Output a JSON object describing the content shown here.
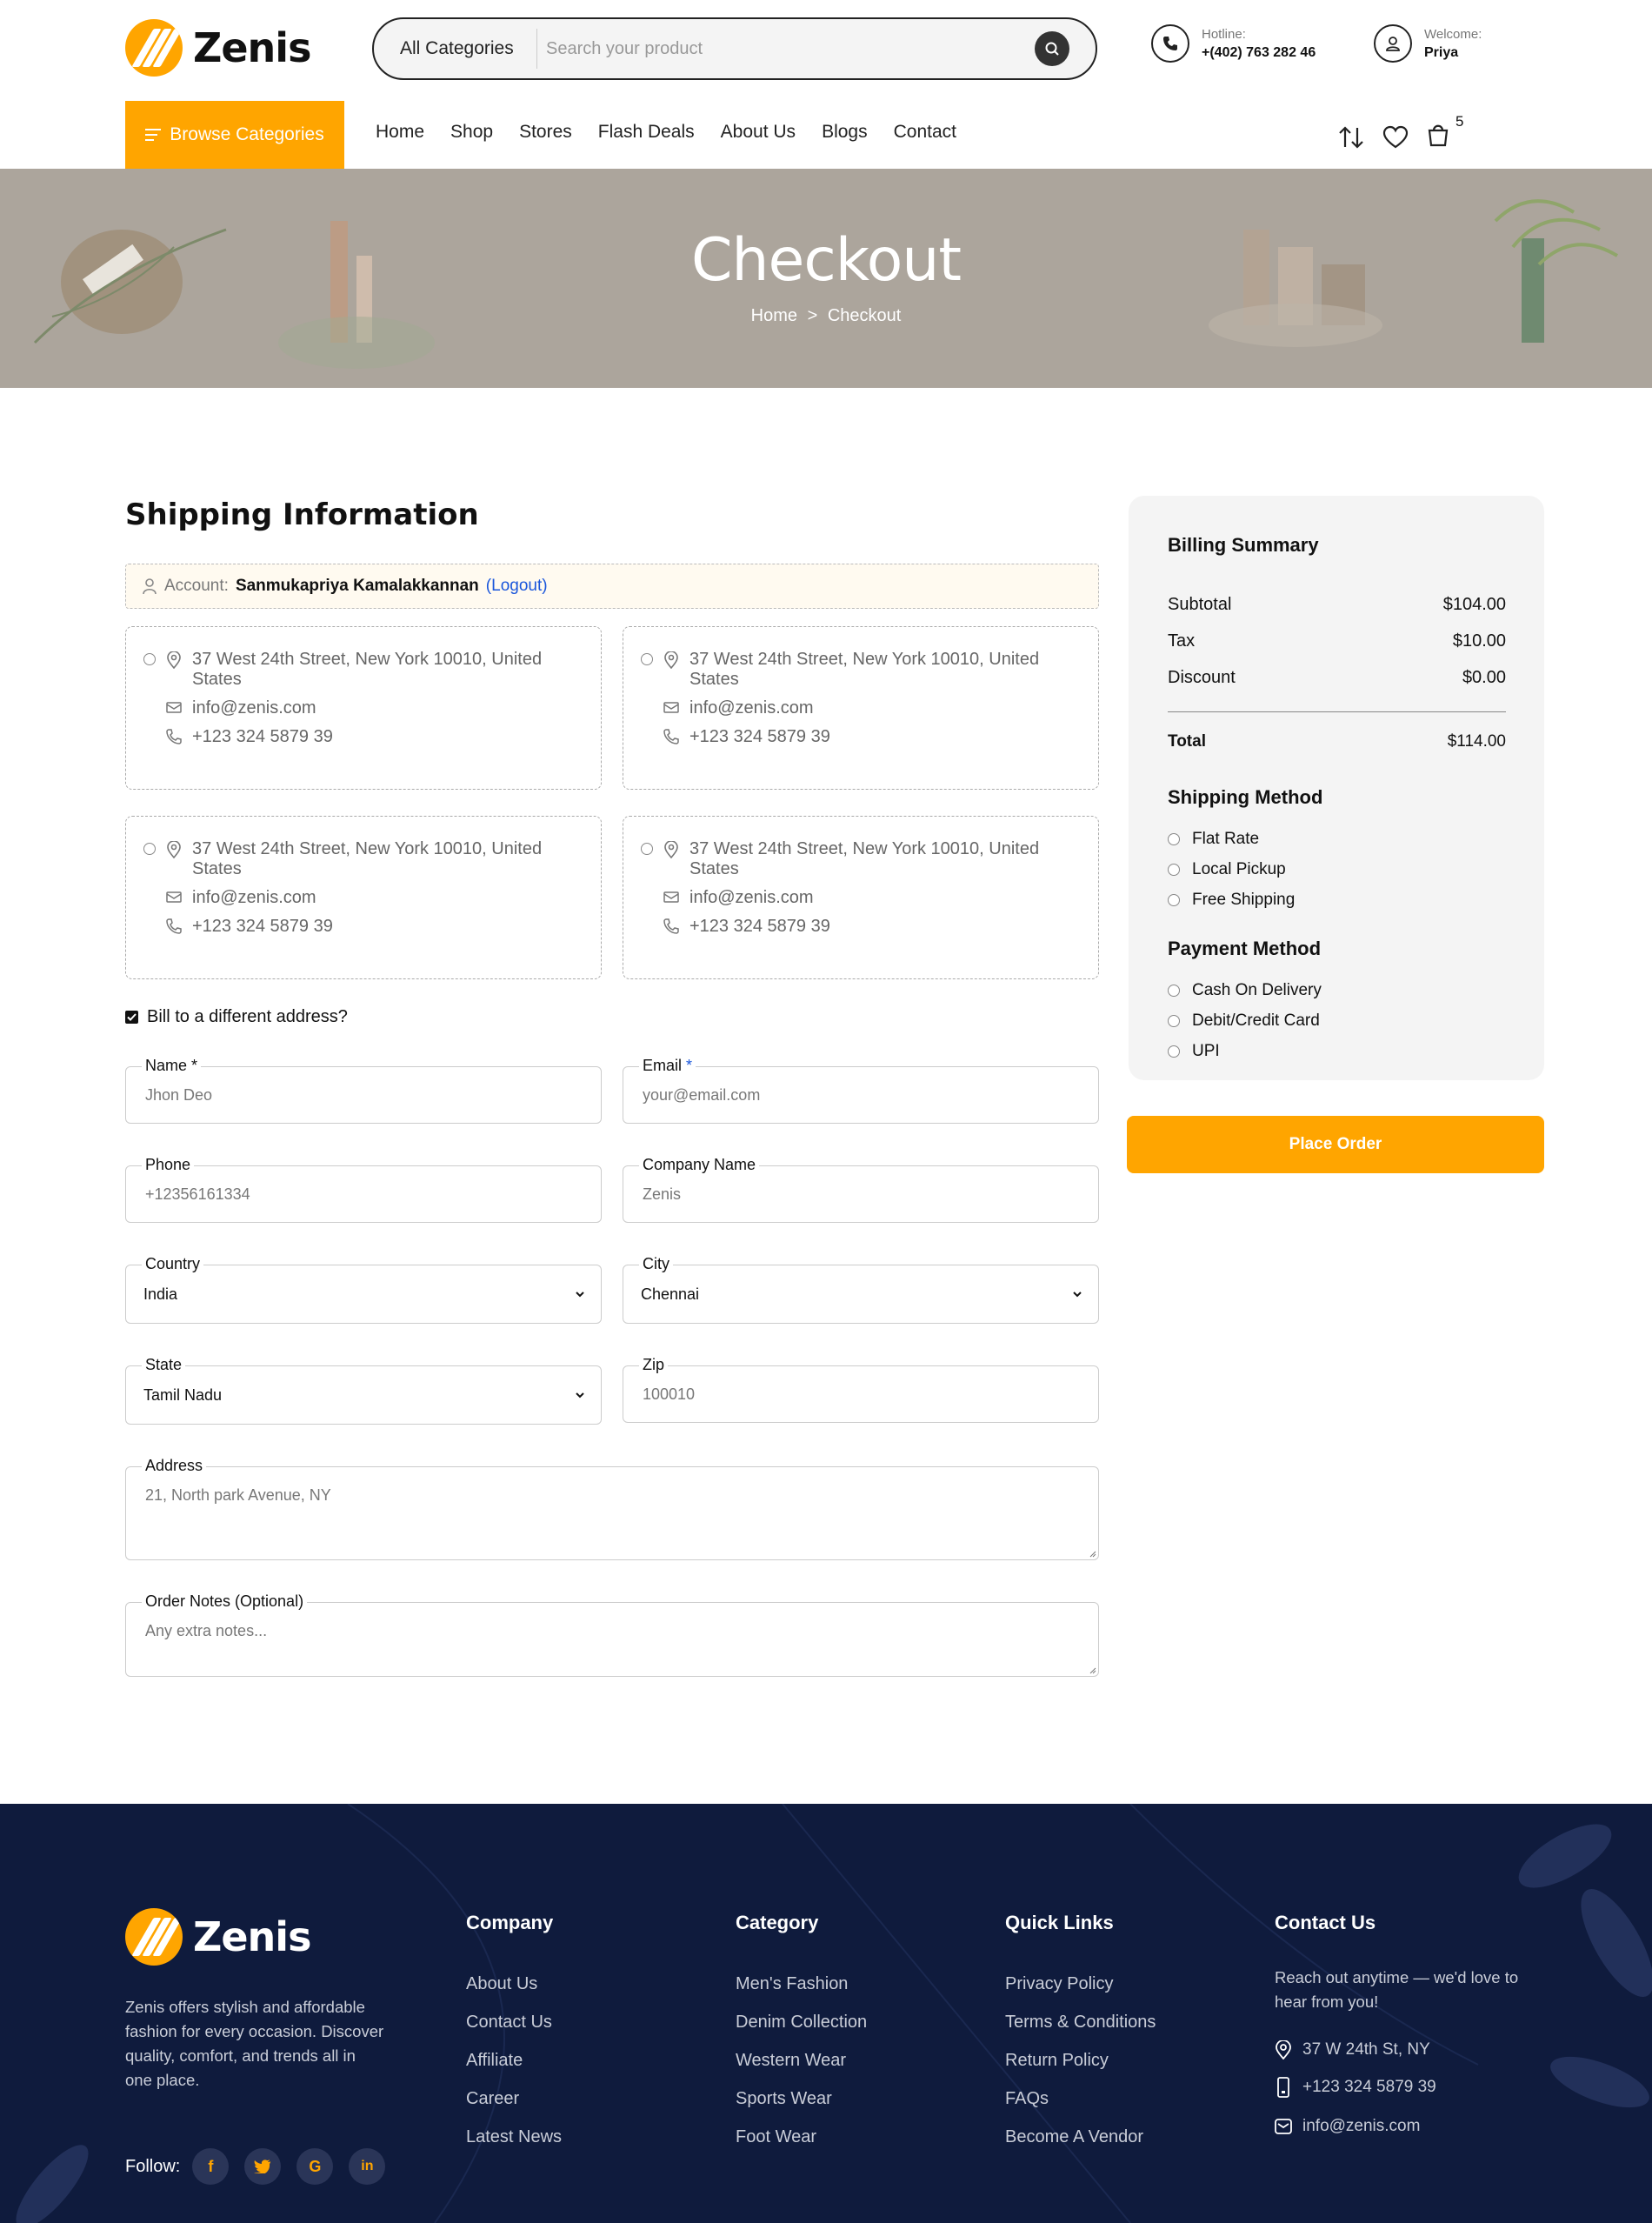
{
  "header": {
    "brand": "Zenis",
    "search_category": "All Categories",
    "search_placeholder": "Search your product",
    "hotline_label": "Hotline:",
    "hotline_number": "+(402) 763 282 46",
    "welcome_label": "Welcome:",
    "welcome_user": "Priya",
    "browse_label": "Browse Categories",
    "nav": [
      "Home",
      "Shop",
      "Stores",
      "Flash Deals",
      "About Us",
      "Blogs",
      "Contact"
    ],
    "cart_count": "5"
  },
  "hero": {
    "title": "Checkout",
    "breadcrumb_home": "Home",
    "breadcrumb_sep": ">",
    "breadcrumb_current": "Checkout"
  },
  "shipping": {
    "title": "Shipping Information",
    "account_label": "Account:",
    "account_name": "Sanmukapriya Kamalakkannan",
    "logout": "(Logout)",
    "addresses": [
      {
        "street": "37 West 24th Street, New York 10010, United States",
        "email": "info@zenis.com",
        "phone": "+123 324 5879 39"
      },
      {
        "street": "37 West 24th Street, New York 10010, United States",
        "email": "info@zenis.com",
        "phone": "+123 324 5879 39"
      },
      {
        "street": "37 West 24th Street, New York 10010, United States",
        "email": "info@zenis.com",
        "phone": "+123 324 5879 39"
      },
      {
        "street": "37 West 24th Street, New York 10010, United States",
        "email": "info@zenis.com",
        "phone": "+123 324 5879 39"
      }
    ],
    "bill_different": "Bill to a different address?",
    "form": {
      "name_label": "Name",
      "name_placeholder": "Jhon Deo",
      "email_label": "Email",
      "email_placeholder": "your@email.com",
      "phone_label": "Phone",
      "phone_placeholder": "+12356161334",
      "company_label": "Company Name",
      "company_placeholder": "Zenis",
      "country_label": "Country",
      "country_value": "India",
      "city_label": "City",
      "city_value": "Chennai",
      "state_label": "State",
      "state_value": "Tamil Nadu",
      "zip_label": "Zip",
      "zip_placeholder": "100010",
      "address_label": "Address",
      "address_placeholder": "21, North park Avenue, NY",
      "notes_label": "Order Notes (Optional)",
      "notes_placeholder": "Any extra notes...",
      "required_mark": "*"
    }
  },
  "billing": {
    "title": "Billing Summary",
    "subtotal_label": "Subtotal",
    "subtotal": "$104.00",
    "tax_label": "Tax",
    "tax": "$10.00",
    "discount_label": "Discount",
    "discount": "$0.00",
    "total_label": "Total",
    "total": "$114.00",
    "shipping_title": "Shipping Method",
    "shipping_options": [
      "Flat Rate",
      "Local Pickup",
      "Free Shipping"
    ],
    "payment_title": "Payment Method",
    "payment_options": [
      "Cash On Delivery",
      "Debit/Credit Card",
      "UPI"
    ],
    "place_order": "Place Order"
  },
  "footer": {
    "brand": "Zenis",
    "about": "Zenis offers stylish and affordable fashion for every occasion. Discover quality, comfort, and trends all in one place.",
    "follow": "Follow:",
    "company_title": "Company",
    "company_links": [
      "About Us",
      "Contact Us",
      "Affiliate",
      "Career",
      "Latest News"
    ],
    "category_title": "Category",
    "category_links": [
      "Men's Fashion",
      "Denim Collection",
      "Western Wear",
      "Sports Wear",
      "Foot Wear"
    ],
    "quick_title": "Quick Links",
    "quick_links": [
      "Privacy Policy",
      "Terms & Conditions",
      "Return Policy",
      "FAQs",
      "Become A Vendor"
    ],
    "contact_title": "Contact Us",
    "contact_text": "Reach out anytime — we'd love to hear from you!",
    "contact_address": "37 W 24th St, NY",
    "contact_phone": "+123 324 5879 39",
    "contact_email": "info@zenis.com"
  },
  "colors": {
    "accent": "#ffa500",
    "hero_bg": "#aca59c",
    "footer_bg": "#0f1b3d",
    "link": "#1a56db"
  }
}
